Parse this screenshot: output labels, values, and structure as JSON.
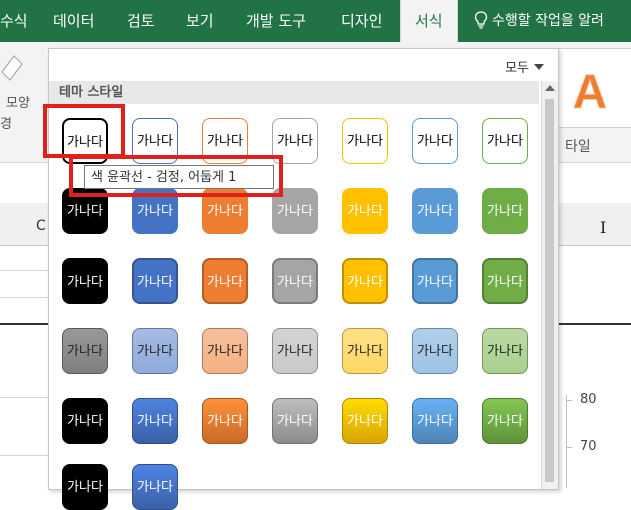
{
  "ribbon": {
    "tabs": [
      {
        "label": "수식",
        "active": false
      },
      {
        "label": "데이터",
        "active": false
      },
      {
        "label": "검토",
        "active": false
      },
      {
        "label": "보기",
        "active": false
      },
      {
        "label": "개발 도구",
        "active": false
      },
      {
        "label": "디자인",
        "active": false
      },
      {
        "label": "서식",
        "active": true
      }
    ],
    "tell_me": "수행할 작업을 알려",
    "left_label_1": "모양",
    "left_label_2": "경",
    "right_label": "타일",
    "wordart_letter": "A"
  },
  "sheet": {
    "column_c": "C",
    "column_i": "I",
    "axis_labels": [
      "80",
      "70"
    ]
  },
  "gallery": {
    "all_button": "모두",
    "section_title": "테마 스타일",
    "tile_text": "가나다",
    "tooltip": "색 윤곽선 - 검정, 어둡게 1",
    "rows": [
      {
        "style": "outline",
        "colors": [
          "#000000",
          "#4472c4",
          "#ed7d31",
          "#a5a5a5",
          "#ffc000",
          "#5b9bd5",
          "#70ad47"
        ]
      },
      {
        "style": "solid",
        "colors": [
          "#000000",
          "#4472c4",
          "#ed7d31",
          "#a5a5a5",
          "#ffc000",
          "#5b9bd5",
          "#70ad47"
        ]
      },
      {
        "style": "solid-border",
        "colors": [
          "#000000",
          "#4472c4",
          "#ed7d31",
          "#a5a5a5",
          "#ffc000",
          "#5b9bd5",
          "#70ad47"
        ]
      },
      {
        "style": "light-grad",
        "colors": [
          "#7f7f7f",
          "#8faadc",
          "#f4b183",
          "#c9c9c9",
          "#ffd966",
          "#9dc3e6",
          "#a9d18e"
        ]
      },
      {
        "style": "intense",
        "colors": [
          "#000000",
          "#4472c4",
          "#ed7d31",
          "#a5a5a5",
          "#ffc000",
          "#5b9bd5",
          "#70ad47"
        ]
      },
      {
        "style": "intense",
        "colors": [
          "#000000",
          "#4472c4"
        ]
      }
    ]
  },
  "colors": {
    "excel_green": "#217346",
    "highlight_red": "#e0201b",
    "wordart_orange": "#ed7d31"
  }
}
